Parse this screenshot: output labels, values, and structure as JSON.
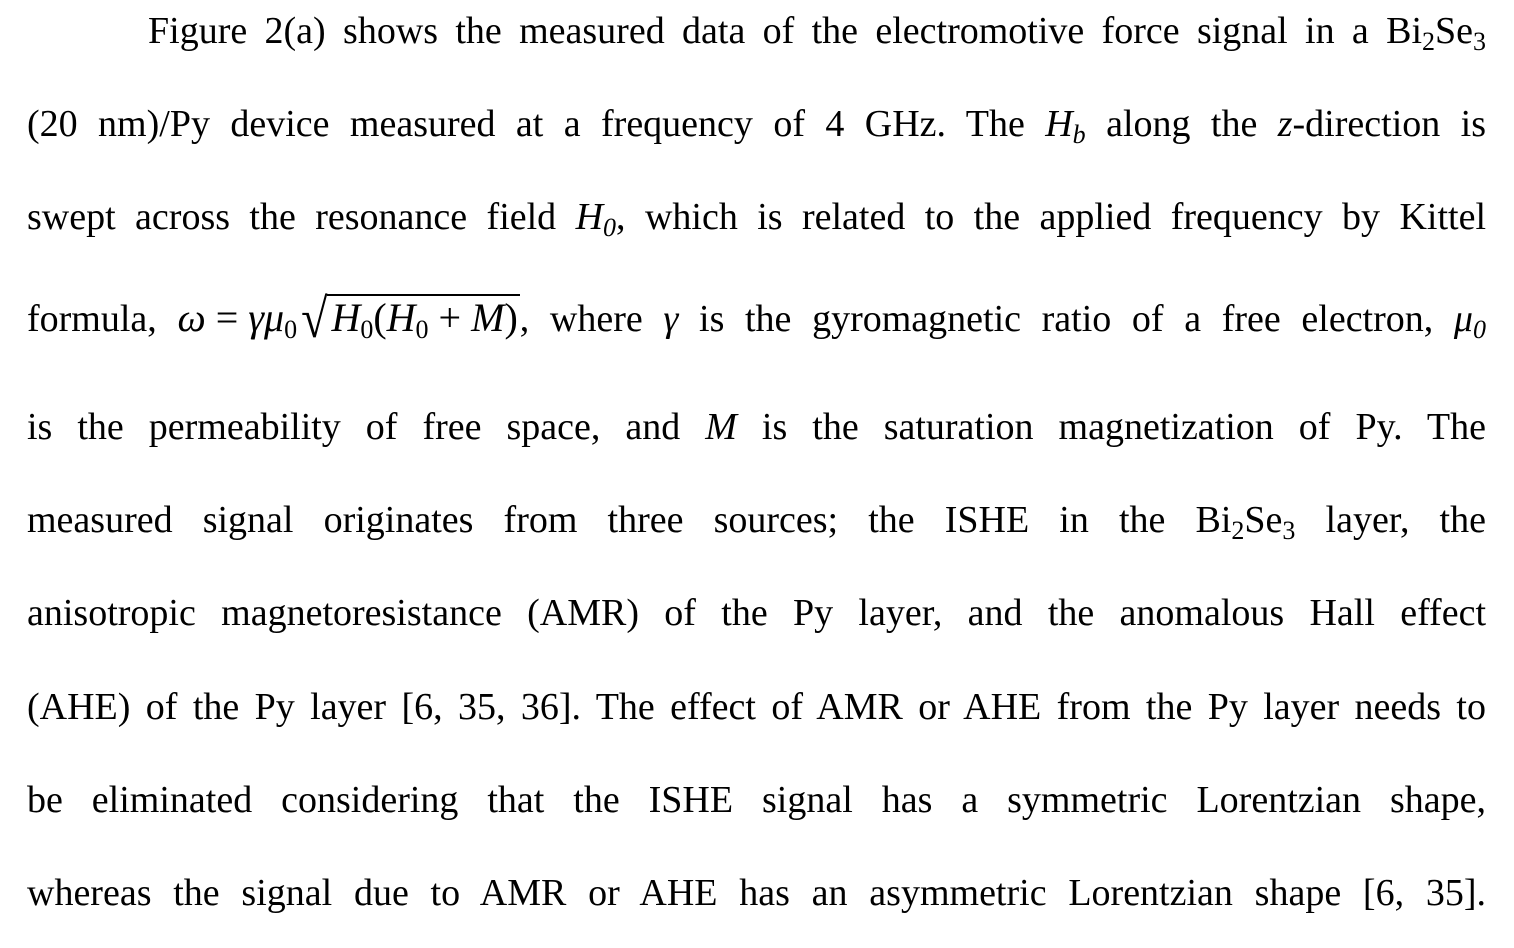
{
  "paragraph": {
    "line1": {
      "pre": "Figure 2(a) shows the measured data of the electromotive force signal in a Bi",
      "sub1": "2",
      "mid": "Se",
      "sub2": "3"
    },
    "line2": {
      "pre": "(20 nm)/Py device measured at a frequency of 4 GHz. The ",
      "h": "H",
      "hsub": "b",
      "mid": " along the ",
      "z": "z",
      "post": "-direction is"
    },
    "line3": {
      "pre": "swept across the resonance field ",
      "h": "H",
      "hsub": "0",
      "post": ", which is related to the applied frequency by Kittel"
    },
    "line4": {
      "pre": "formula, ",
      "eq_omega": "ω",
      "eq_equals": " = ",
      "eq_gamma": "γμ",
      "eq_gsub": "0",
      "eq_h1": "H",
      "eq_h1sub": "0",
      "eq_open": "(",
      "eq_h2": "H",
      "eq_h2sub": "0",
      "eq_plus": " + ",
      "eq_m": "M",
      "eq_close": ")",
      "mid": ", where ",
      "gamma": "γ",
      "post": " is the gyromagnetic ratio of a free electron, ",
      "mu": "μ",
      "musub": "0"
    },
    "line5": {
      "pre": "is the permeability of free space, and ",
      "m": "M",
      "post": " is the saturation magnetization of Py. The"
    },
    "line6": {
      "pre": "measured signal originates from three sources; the ISHE in the Bi",
      "sub1": "2",
      "mid": "Se",
      "sub2": "3",
      "post": " layer, the"
    },
    "line7": "anisotropic magnetoresistance (AMR) of the Py layer, and the anomalous Hall effect",
    "line8": "(AHE) of the Py layer [6, 35, 36]. The effect of AMR or AHE from the Py layer needs to",
    "line9": "be eliminated considering that the ISHE signal has a symmetric Lorentzian shape,",
    "line10": "whereas the signal due to AMR or AHE has an asymmetric Lorentzian shape [6, 35]."
  }
}
